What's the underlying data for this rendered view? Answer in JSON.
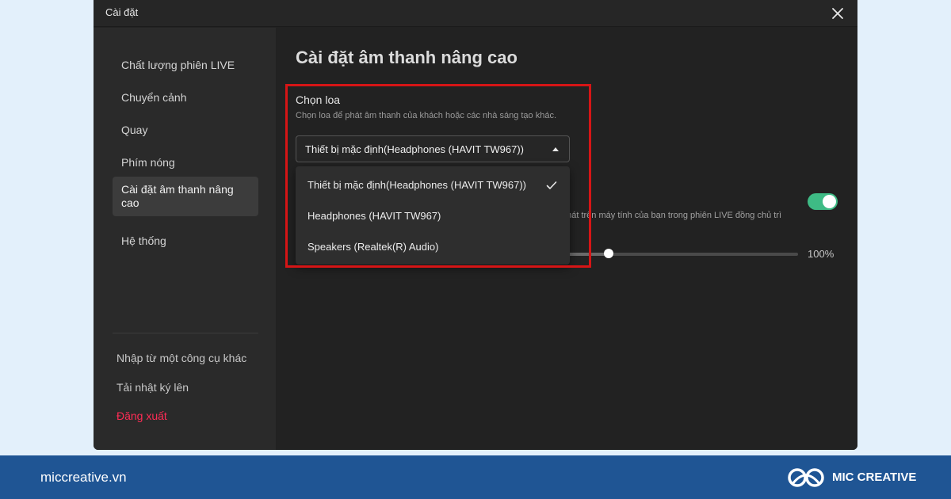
{
  "window": {
    "title": "Cài đặt",
    "close_icon": "close-icon"
  },
  "sidebar": {
    "items": [
      {
        "label": "Chất lượng phiên LIVE"
      },
      {
        "label": "Chuyển cảnh"
      },
      {
        "label": "Quay"
      },
      {
        "label": "Phím nóng"
      },
      {
        "label": "Cài đặt âm thanh nâng cao",
        "active": true
      },
      {
        "label": "Hệ thống"
      }
    ],
    "footer": [
      {
        "label": "Nhập từ một công cụ khác"
      },
      {
        "label": "Tải nhật ký lên"
      },
      {
        "label": "Đăng xuất"
      }
    ]
  },
  "main": {
    "title": "Cài đặt âm thanh nâng cao",
    "speaker": {
      "label": "Chọn loa",
      "description": "Chọn loa để phát âm thanh của khách hoặc các nhà sáng tạo khác.",
      "selected": "Thiết bị mặc định(Headphones (HAVIT TW967))",
      "options": [
        {
          "label": "Thiết bị mặc định(Headphones (HAVIT TW967))",
          "checked": true
        },
        {
          "label": "Headphones (HAVIT TW967)"
        },
        {
          "label": "Speakers (Realtek(R) Audio)"
        }
      ]
    },
    "monitor": {
      "description_fragment": "phát trên máy tính của bạn trong phiên LIVE đồng chủ trì",
      "enabled": true
    },
    "volume": {
      "value_label": "100%",
      "level_fraction": 0.19
    }
  },
  "colors": {
    "accent_toggle": "#3ebb85",
    "danger": "#fe2c55",
    "highlight": "#d61516",
    "footer_bg": "#1f5594"
  },
  "footer": {
    "url": "miccreative.vn",
    "brand": "MIC CREATIVE"
  }
}
